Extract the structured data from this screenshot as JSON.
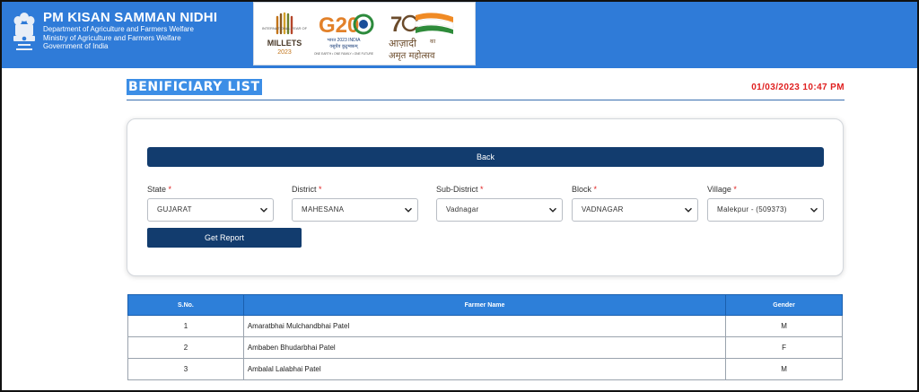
{
  "header": {
    "title": "PM KISAN SAMMAN NIDHI",
    "lines": [
      "Department of Agriculture and Farmers Welfare",
      "Ministry of Agriculture and Farmers Welfare",
      "Government of India"
    ],
    "bg_color": "#2f7bd8",
    "logos": {
      "millets_small": "INTERNATIONAL YEAR OF",
      "millets_word": "MILLETS",
      "millets_year": "2023",
      "g20_word": "G20",
      "g20_hindi": "भारत 2023 INDIA",
      "g20_hindi2": "वसुधैव कुटुम्बकम्",
      "g20_tagline": "ONE EARTH • ONE FAMILY • ONE FUTURE",
      "azadi_hindi": "आज़ादी",
      "azadi_ka": "का",
      "azadi_line2": "अमृत महोत्सव"
    }
  },
  "page": {
    "title": "BENIFICIARY LIST",
    "datetime": "01/03/2023 10:47 PM"
  },
  "form": {
    "back_label": "Back",
    "report_label": "Get Report",
    "required_mark": "*",
    "fields": [
      {
        "label": "State",
        "value": "GUJARAT"
      },
      {
        "label": "District",
        "value": "MAHESANA"
      },
      {
        "label": "Sub-District",
        "value": "Vadnagar"
      },
      {
        "label": "Block",
        "value": "VADNAGAR"
      },
      {
        "label": "Village",
        "value": "Malekpur - (509373)"
      }
    ]
  },
  "table": {
    "headers": [
      "S.No.",
      "Farmer Name",
      "Gender"
    ],
    "rows": [
      {
        "sno": "1",
        "name": "Amaratbhai Mulchandbhai Patel",
        "gender": "M"
      },
      {
        "sno": "2",
        "name": "Ambaben Bhudarbhai Patel",
        "gender": "F"
      },
      {
        "sno": "3",
        "name": "Ambalal Lalabhai Patel",
        "gender": "M"
      }
    ],
    "header_color": "#2d7fd9"
  },
  "icons": {
    "emblem": "national-emblem-icon",
    "chevron": "chevron-down-icon"
  }
}
